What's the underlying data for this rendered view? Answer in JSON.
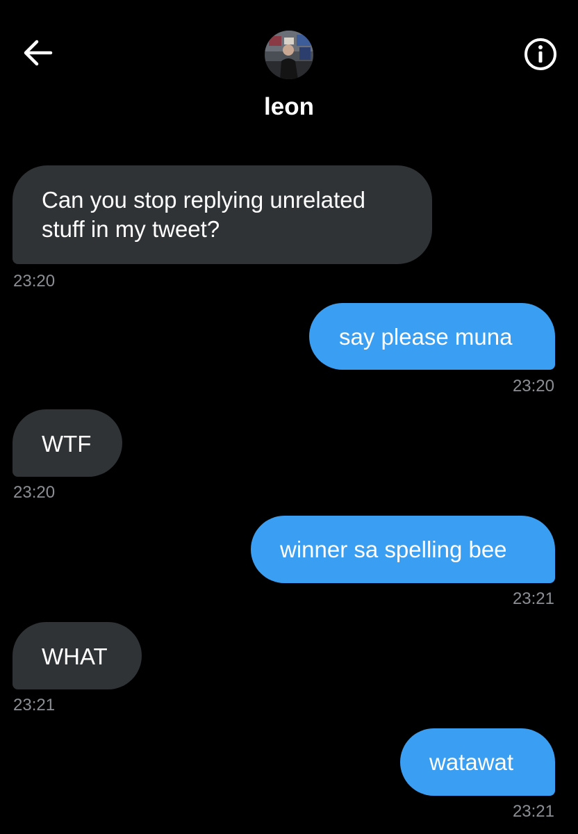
{
  "header": {
    "contact_name": "leon",
    "back_icon": "arrow-left-icon",
    "info_icon": "info-circle-icon"
  },
  "messages": [
    {
      "direction": "received",
      "text": "Can you stop replying unrelated stuff in my tweet?",
      "time": "23:20"
    },
    {
      "direction": "sent",
      "text": "say please muna",
      "time": "23:20"
    },
    {
      "direction": "received",
      "text": "WTF",
      "time": "23:20"
    },
    {
      "direction": "sent",
      "text": "winner sa spelling bee",
      "time": "23:21"
    },
    {
      "direction": "received",
      "text": "WHAT",
      "time": "23:21"
    },
    {
      "direction": "sent",
      "text": "watawat",
      "time": "23:21"
    }
  ],
  "colors": {
    "background": "#000000",
    "received_bubble": "#2f3336",
    "sent_bubble": "#3a9ef2",
    "timestamp": "#8b8f94"
  }
}
